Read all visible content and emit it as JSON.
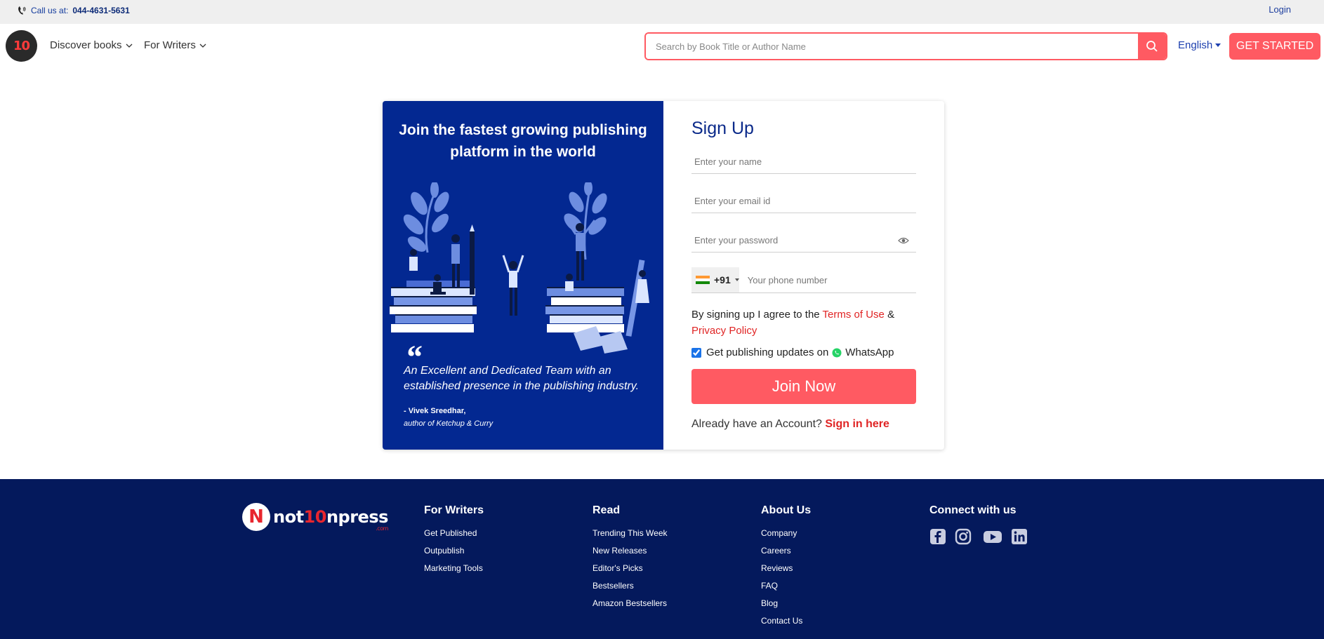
{
  "topbar": {
    "call_prefix": "Call us at:",
    "call_number": "044-4631-5631",
    "login": "Login"
  },
  "header": {
    "logo_text": "10",
    "nav": [
      {
        "label": "Discover books"
      },
      {
        "label": "For Writers"
      }
    ],
    "search_placeholder": "Search by Book Title or Author Name",
    "language": "English",
    "cta": "GET STARTED"
  },
  "promo": {
    "heading": "Join the fastest growing publishing platform in the world",
    "quote_mark": "“",
    "quote": "An Excellent and Dedicated Team with an established presence in the publishing industry.",
    "author": "- Vivek Sreedhar,",
    "book": "author of Ketchup & Curry"
  },
  "signup": {
    "title": "Sign Up",
    "name_placeholder": "Enter your name",
    "email_placeholder": "Enter your email id",
    "password_placeholder": "Enter your password",
    "country_code": "+91",
    "phone_placeholder": "Your phone number",
    "agree_prefix": "By signing up I agree to the",
    "terms": "Terms of Use",
    "amp": "&",
    "privacy": "Privacy Policy",
    "whatsapp_prefix": "Get publishing updates on",
    "whatsapp": "WhatsApp",
    "whatsapp_checked": true,
    "submit": "Join Now",
    "have_account": "Already have an Account?",
    "signin": "Sign in here"
  },
  "footer": {
    "logo": {
      "part1": "not",
      "part2": "10",
      "part3": "npress",
      "tld": ".com"
    },
    "columns": [
      {
        "title": "For Writers",
        "links": [
          "Get Published",
          "Outpublish",
          "Marketing Tools"
        ]
      },
      {
        "title": "Read",
        "links": [
          "Trending This Week",
          "New Releases",
          "Editor's Picks",
          "Bestsellers",
          "Amazon Bestsellers"
        ]
      },
      {
        "title": "About Us",
        "links": [
          "Company",
          "Careers",
          "Reviews",
          "FAQ",
          "Blog",
          "Contact Us"
        ]
      }
    ],
    "connect_title": "Connect with us",
    "social": [
      "facebook-icon",
      "instagram-icon",
      "youtube-icon",
      "linkedin-icon"
    ]
  },
  "colors": {
    "accent": "#ff5a62",
    "navy": "#032891",
    "footer": "#04195c",
    "link_red": "#e02424"
  }
}
